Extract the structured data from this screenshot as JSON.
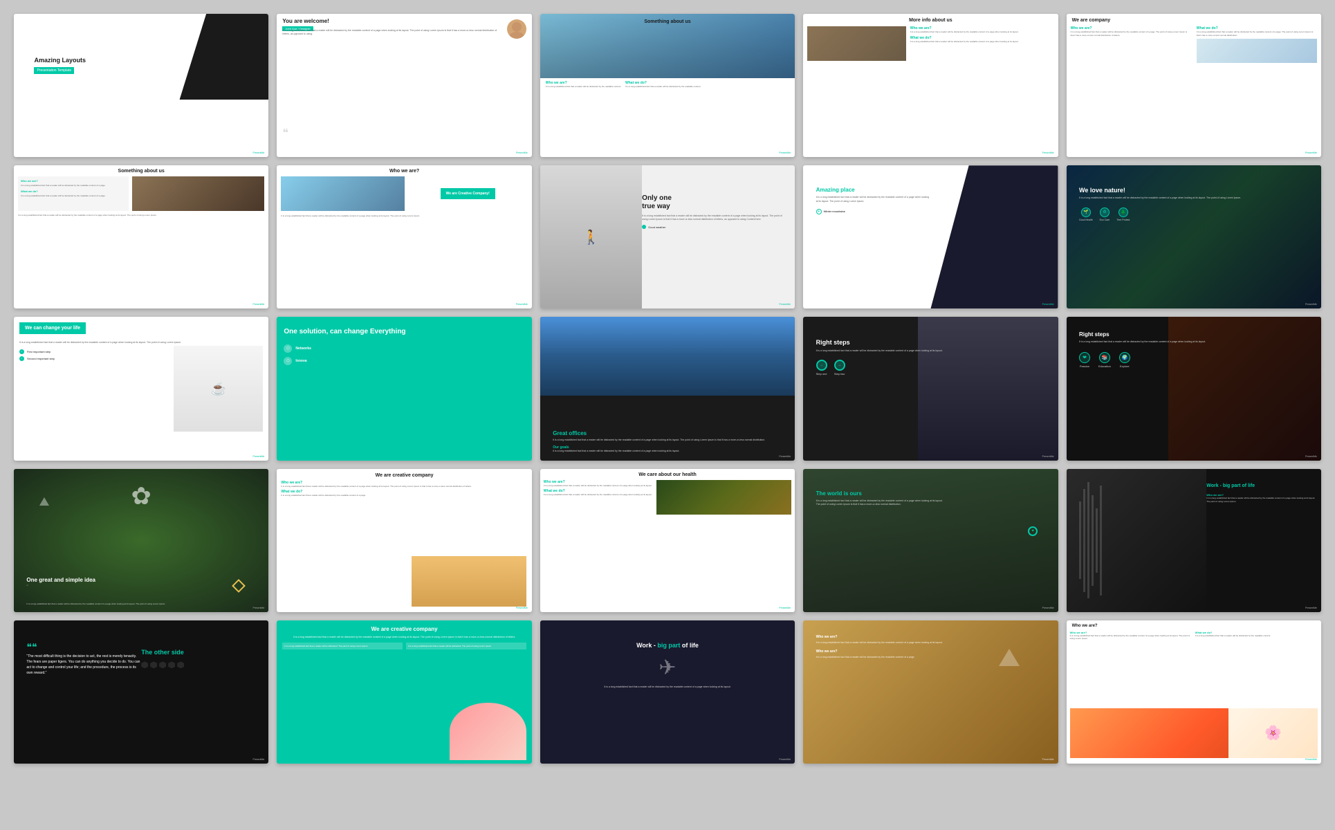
{
  "slides": [
    {
      "id": 1,
      "title": "Amazing Layouts",
      "subtitle": "Presentation Template",
      "type": "cover"
    },
    {
      "id": 2,
      "title": "You are welcome!",
      "name": "John Doe / Designer",
      "type": "welcome"
    },
    {
      "id": 3,
      "title": "Something about us",
      "who_label": "Who we are?",
      "what_label": "What we do?",
      "type": "about"
    },
    {
      "id": 4,
      "title": "More info about us",
      "who_label": "Who we are?",
      "what_label": "What we do?",
      "type": "info"
    },
    {
      "id": 5,
      "title": "We are company",
      "who_label": "Who we are?",
      "what_label": "What we do?",
      "type": "company"
    },
    {
      "id": 6,
      "title": "Something about us",
      "who_label": "Who we are?",
      "what_label": "What we do?",
      "type": "about2"
    },
    {
      "id": 7,
      "title": "Who we are?",
      "badge": "We are Creative Company!",
      "type": "whoweare"
    },
    {
      "id": 8,
      "title": "Only one true way",
      "tag1": "Good weather",
      "type": "trueway"
    },
    {
      "id": 9,
      "title": "Amazing",
      "title2": "place",
      "tag": "Winter mountains",
      "type": "amazingplace"
    },
    {
      "id": 10,
      "title": "We love nature!",
      "icons": [
        "Good Health",
        "Eco Care",
        "Tree Protect"
      ],
      "type": "nature"
    },
    {
      "id": 11,
      "title": "We can change your life",
      "step1": "First important step",
      "step2": "Second important step",
      "type": "change"
    },
    {
      "id": 12,
      "title": "One solution, can change Everything",
      "item1": "Networks",
      "item2": "Innova",
      "type": "solution"
    },
    {
      "id": 13,
      "title": "Great",
      "title2": "offices",
      "goals": "Our goals",
      "type": "offices"
    },
    {
      "id": 14,
      "title": "Right steps",
      "step1": "Step one",
      "step2": "Step two",
      "type": "rightsteps1"
    },
    {
      "id": 15,
      "title": "Right steps",
      "icons": [
        "Passion",
        "Education",
        "Explore"
      ],
      "type": "rightsteps2"
    },
    {
      "id": 16,
      "title": "One great and simple idea",
      "type": "idea"
    },
    {
      "id": 17,
      "title": "We are creative company",
      "who_label": "Who we are?",
      "what_label": "What we do?",
      "type": "creative1"
    },
    {
      "id": 18,
      "title": "We care about our health",
      "who_label": "Who we are?",
      "what_label": "What we do?",
      "type": "health"
    },
    {
      "id": 19,
      "title": "The world is",
      "title2": "ours",
      "type": "world"
    },
    {
      "id": 20,
      "title": "Work - big part",
      "title2": "of life",
      "who_label": "Who we are?",
      "type": "worklife1"
    },
    {
      "id": 21,
      "title": "The other",
      "title2": "side",
      "quote": "“The most difficult thing is the decision to act, the rest is merely tenacity. The fears are paper tigers. You can do anything you decide to do. You can act to change and control your life; and the procedure, the process is its own reward.”",
      "type": "otherside"
    },
    {
      "id": 22,
      "title": "We are creative company",
      "type": "creative2"
    },
    {
      "id": 23,
      "title": "Work - big part of life",
      "type": "worklife2"
    },
    {
      "id": 24,
      "who_label": "Who we are?",
      "what_label": "Who we are?",
      "type": "desert"
    },
    {
      "id": 25,
      "who_label": "Who we are?",
      "what_label": "What we do?",
      "type": "sunset"
    }
  ],
  "brand": "PresentMe",
  "accent_color": "#00c9a7"
}
